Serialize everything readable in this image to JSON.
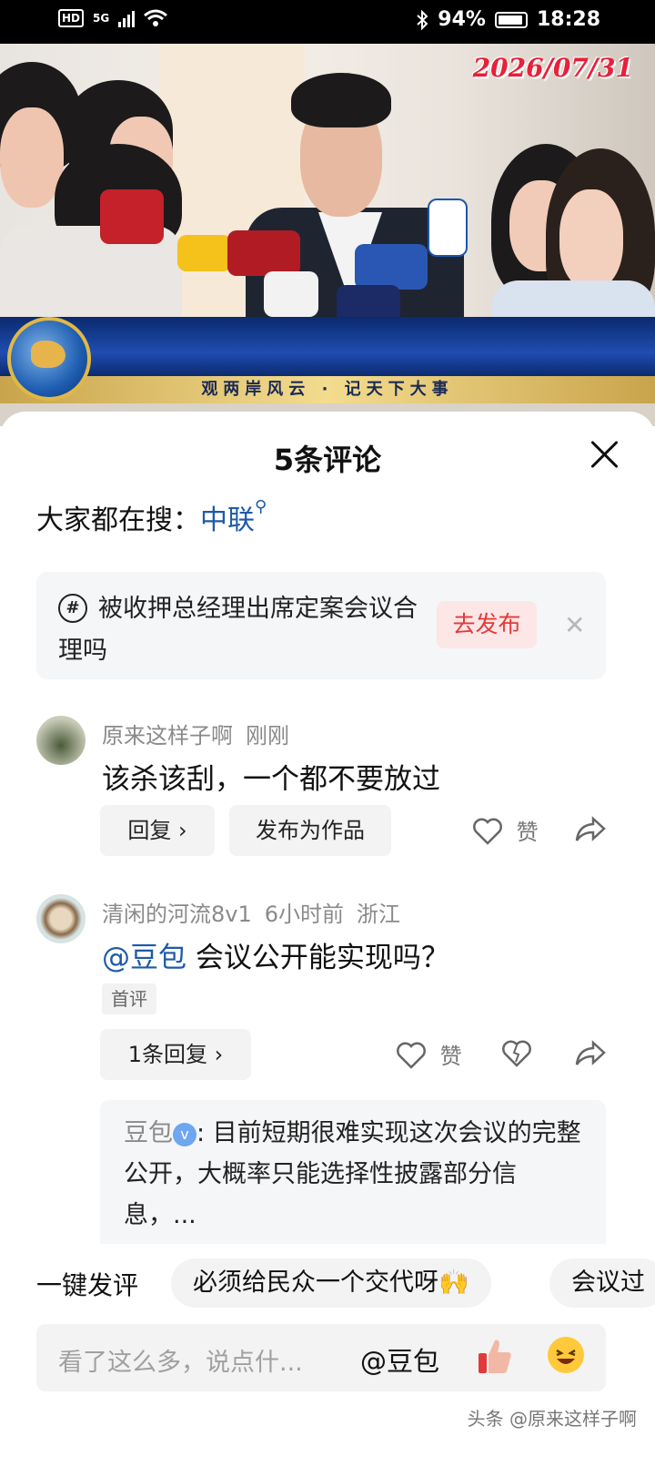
{
  "status_bar": {
    "hd": "HD",
    "network": "5G",
    "battery_percent": "94%",
    "time": "18:28",
    "icons": [
      "hd-icon",
      "signal-icon",
      "wifi-icon",
      "bluetooth-icon",
      "battery-icon"
    ]
  },
  "video": {
    "date_stamp": "2026/07/31",
    "ticker": "观两岸风云 · 记天下大事"
  },
  "sheet": {
    "title": "5条评论",
    "search_label": "大家都在搜：",
    "search_term": "中联"
  },
  "topic": {
    "text": "被收押总经理出席定案会议合理吗",
    "publish_label": "去发布"
  },
  "comments": [
    {
      "user": "原来这样子啊",
      "time": "刚刚",
      "text": "该杀该刮，一个都不要放过",
      "reply_label": "回复",
      "publish_label": "发布为作品",
      "like_label": "赞"
    },
    {
      "user": "清闲的河流8v1",
      "time": "6小时前",
      "location": "浙江",
      "mention": "@豆包",
      "text": "会议公开能实现吗？",
      "tag": "首评",
      "replies_label": "1条回复",
      "like_label": "赞",
      "reply_preview": {
        "name": "豆包",
        "text": ": 目前短期很难实现这次会议的完整公开，大概率只能选择性披露部分信息，..."
      }
    }
  ],
  "quick_comments": {
    "label": "一键发评",
    "chips": [
      "必须给民众一个交代呀🙌",
      "会议过"
    ]
  },
  "input": {
    "placeholder": "看了这么多，说点什...",
    "mention": "@豆包"
  },
  "watermark": "头条 @原来这样子啊"
}
